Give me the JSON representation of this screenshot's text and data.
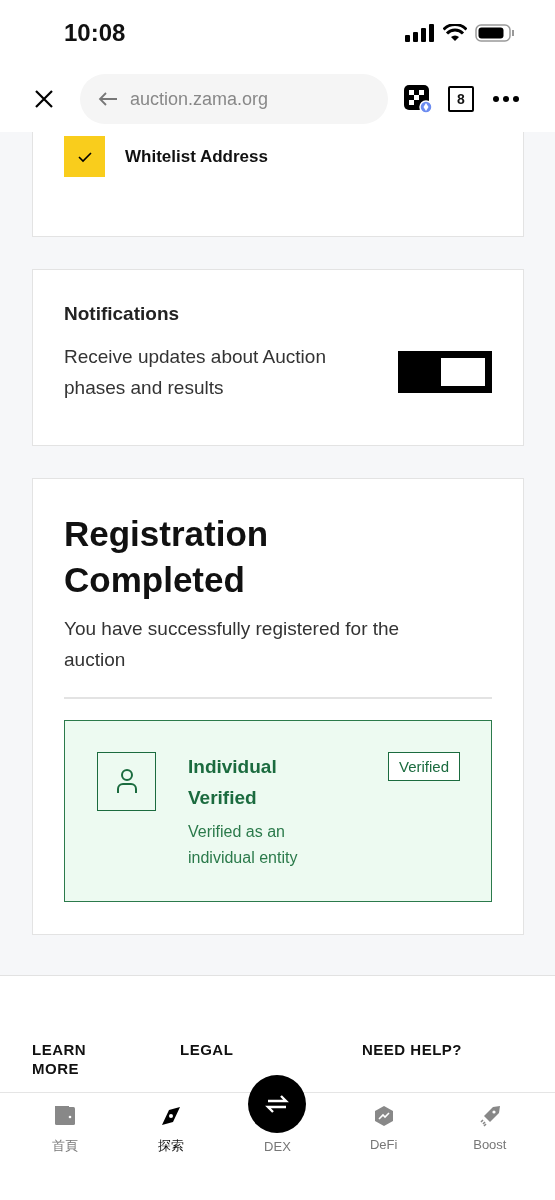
{
  "status_bar": {
    "time": "10:08"
  },
  "browser": {
    "url": "auction.zama.org",
    "tab_count": "8"
  },
  "whitelist": {
    "checked": true,
    "label": "Whitelist Address"
  },
  "notifications": {
    "title": "Notifications",
    "description": "Receive updates about Auction phases and results",
    "toggle": {
      "on": true
    }
  },
  "registration": {
    "title": "Registration Completed",
    "message": "You have successfully registered for the auction",
    "verification": {
      "title": "Individual Verified",
      "description": "Verified as an individual entity",
      "badge": "Verified"
    }
  },
  "footer": {
    "columns": [
      {
        "heading": "LEARN MORE"
      },
      {
        "heading": "LEGAL"
      },
      {
        "heading": "NEED HELP?"
      }
    ]
  },
  "nav": [
    {
      "kind": "wallet",
      "label": "首頁",
      "selected": false
    },
    {
      "kind": "compass",
      "label": "探索",
      "selected": true
    },
    {
      "kind": "swap",
      "label": "DEX",
      "selected": false
    },
    {
      "kind": "defi",
      "label": "DeFi",
      "selected": false
    },
    {
      "kind": "rocket",
      "label": "Boost",
      "selected": false
    }
  ]
}
